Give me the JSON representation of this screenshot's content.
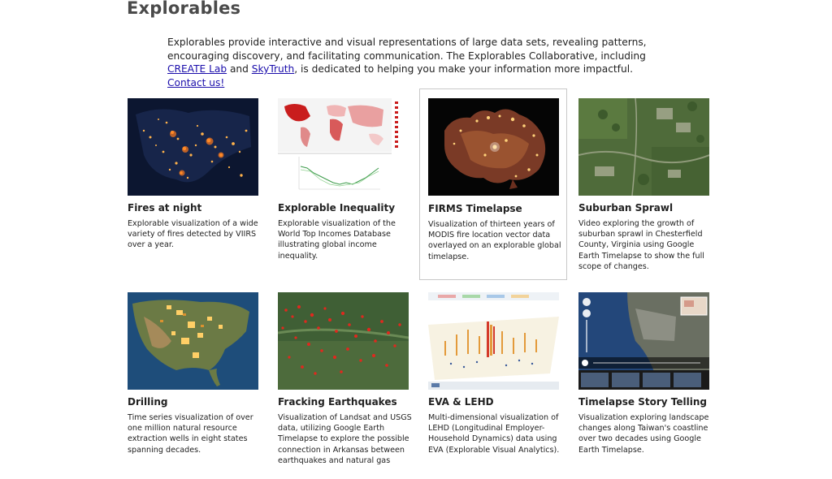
{
  "page": {
    "title": "Explorables",
    "intro": {
      "text_before": "Explorables provide interactive and visual representations of large data sets, revealing patterns, encouraging discovery, and facilitating communication. The Explorables Collaborative, including ",
      "link_create": "CREATE Lab",
      "text_and": " and ",
      "link_skytruth": "SkyTruth",
      "text_after": ", is dedicated to helping you make your information more impactful. ",
      "link_contact": "Contact us!"
    }
  },
  "cards": [
    {
      "title": "Fires at night",
      "description": "Explorable visualization of a wide variety of fires detected by VIIRS over a year.",
      "thumbnail_icon": "night-fire-map"
    },
    {
      "title": "Explorable Inequality",
      "description": "Explorable visualization of the World Top Incomes Database illustrating global income inequality.",
      "thumbnail_icon": "world-choropleth-chart"
    },
    {
      "title": "FIRMS Timelapse",
      "description": "Visualization of thirteen years of MODIS fire location vector data overlayed on an explorable global timelapse.",
      "thumbnail_icon": "australia-fire-map"
    },
    {
      "title": "Suburban Sprawl",
      "description": "Video exploring the growth of suburban sprawl in Chesterfield County, Virginia using Google Earth Timelapse to show the full scope of changes.",
      "thumbnail_icon": "satellite-sprawl"
    },
    {
      "title": "Drilling",
      "description": "Time series visualization of over one million natural resource extraction wells in eight states spanning decades.",
      "thumbnail_icon": "us-wells-map"
    },
    {
      "title": "Fracking Earthquakes",
      "description": "Visualization of Landsat and USGS data, utilizing Google Earth Timelapse to explore the possible connection in Arkansas between earthquakes and natural gas",
      "thumbnail_icon": "earthquake-dots-map"
    },
    {
      "title": "EVA & LEHD",
      "description": "Multi-dimensional visualization of LEHD (Longitudinal Employer-Household Dynamics) data using EVA (Explorable Visual Analytics).",
      "thumbnail_icon": "employment-3d-map"
    },
    {
      "title": "Timelapse Story Telling",
      "description": "Visualization exploring landscape changes along Taiwan's coastline over two decades using Google Earth Timelapse.",
      "thumbnail_icon": "coastline-timelapse"
    }
  ],
  "colors": {
    "heading": "#4a4a4a",
    "link": "#1a0dab",
    "selected_border": "#c8c8c8"
  }
}
